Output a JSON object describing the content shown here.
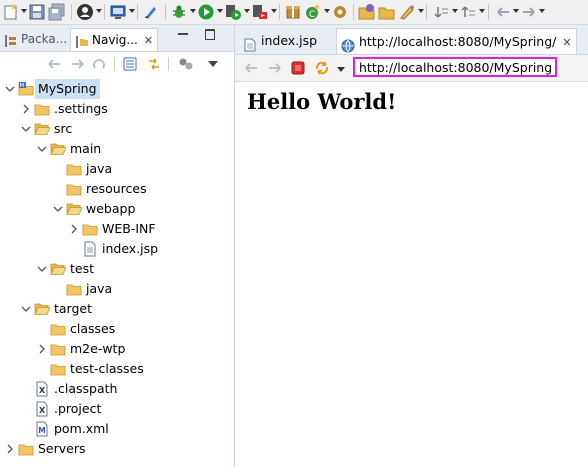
{
  "left_tabs": [
    {
      "label": "Packa..."
    },
    {
      "label": "Navig...",
      "close": "✕"
    }
  ],
  "tree": [
    {
      "label": "MySpring",
      "depth": 0,
      "expanded": true,
      "icon": "project-icon",
      "selected": true
    },
    {
      "label": ".settings",
      "depth": 1,
      "expanded": false,
      "icon": "folder-icon"
    },
    {
      "label": "src",
      "depth": 1,
      "expanded": true,
      "icon": "folder-open-icon"
    },
    {
      "label": "main",
      "depth": 2,
      "expanded": true,
      "icon": "folder-open-icon"
    },
    {
      "label": "java",
      "depth": 3,
      "icon": "folder-icon"
    },
    {
      "label": "resources",
      "depth": 3,
      "icon": "folder-icon"
    },
    {
      "label": "webapp",
      "depth": 3,
      "expanded": true,
      "icon": "folder-open-icon"
    },
    {
      "label": "WEB-INF",
      "depth": 4,
      "expanded": false,
      "icon": "folder-icon"
    },
    {
      "label": "index.jsp",
      "depth": 4,
      "icon": "jsp-file-icon"
    },
    {
      "label": "test",
      "depth": 2,
      "expanded": true,
      "icon": "folder-open-icon"
    },
    {
      "label": "java",
      "depth": 3,
      "icon": "folder-icon"
    },
    {
      "label": "target",
      "depth": 1,
      "expanded": true,
      "icon": "folder-open-icon"
    },
    {
      "label": "classes",
      "depth": 2,
      "icon": "folder-icon"
    },
    {
      "label": "m2e-wtp",
      "depth": 2,
      "expanded": false,
      "icon": "folder-icon"
    },
    {
      "label": "test-classes",
      "depth": 2,
      "icon": "folder-icon"
    },
    {
      "label": ".classpath",
      "depth": 1,
      "icon": "xml-file-icon"
    },
    {
      "label": ".project",
      "depth": 1,
      "icon": "xml-file-icon"
    },
    {
      "label": "pom.xml",
      "depth": 1,
      "icon": "maven-file-icon"
    },
    {
      "label": "Servers",
      "depth": 0,
      "expanded": false,
      "icon": "folder-icon"
    }
  ],
  "editor_tabs": [
    {
      "label": "index.jsp"
    },
    {
      "label": "http://localhost:8080/MySpring/",
      "close": "✕"
    }
  ],
  "browser": {
    "url": "http://localhost:8080/MySpring/",
    "content_heading": "Hello World!"
  },
  "colors": {
    "url_highlight": "#e020e0",
    "selection": "#cce0f5",
    "folder": "#e8b84a"
  }
}
